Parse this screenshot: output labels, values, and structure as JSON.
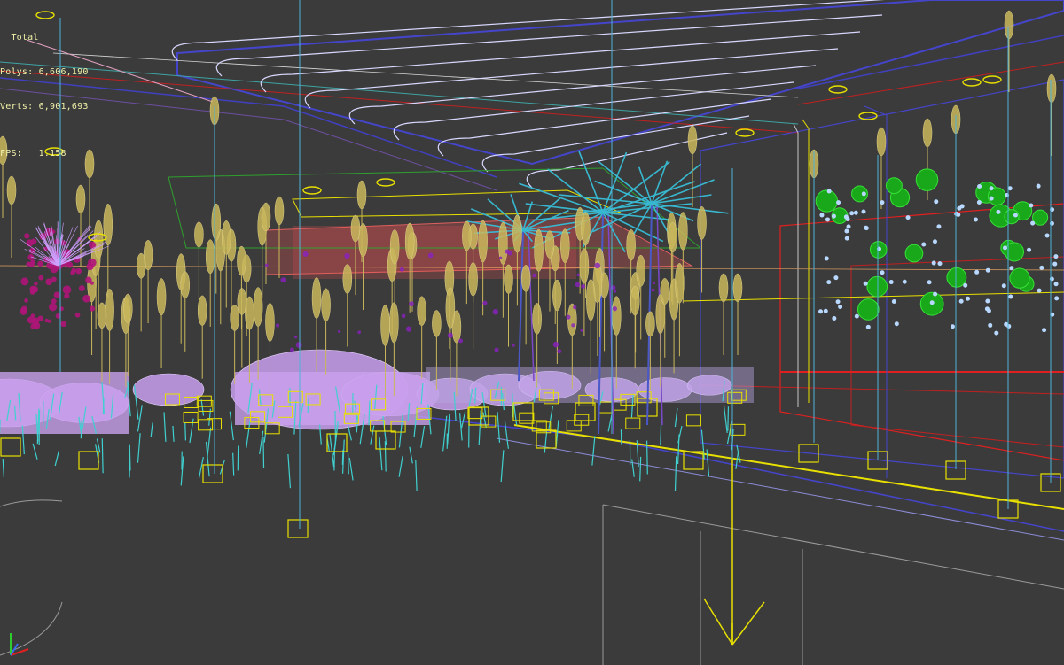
{
  "viewport": {
    "name": "perspective-viewport",
    "background": "#3b3b3b",
    "stats": {
      "total_label": "Total",
      "polys_label": "Polys:",
      "polys_value": "6,606,190",
      "verts_label": "Verts:",
      "verts_value": "6,901,693",
      "fps_label": "FPS:",
      "fps_value": "1.158"
    },
    "colors": {
      "stats_text": "#f0f0a8",
      "ceiling": "#4040c8",
      "ceiling_slats": "#d8d8ff",
      "plants": "#c9b75c",
      "palms": "#38b8d0",
      "tables": "#c9a0ee",
      "chairs": "#40d0d0",
      "lights": "#e8e000",
      "red_lines": "#e02020",
      "green_foliage": "#19a819",
      "stage_back": "#e05050",
      "gray_lines": "#9a9a9a"
    },
    "gizmo": {
      "axis_icon": "xyz-axis-icon",
      "arrow_icon": "light-target-arrow-icon"
    }
  }
}
